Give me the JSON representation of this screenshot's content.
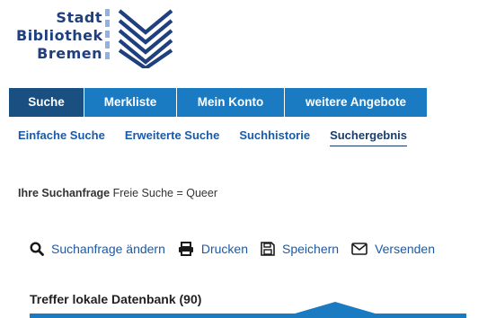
{
  "logo": {
    "line1": "Stadt",
    "line2": "Bibliothek",
    "line3": "Bremen",
    "icon": "book-icon",
    "color": "#1f3f7f"
  },
  "mainnav": {
    "items": [
      {
        "label": "Suche",
        "active": true
      },
      {
        "label": "Merkliste",
        "active": false
      },
      {
        "label": "Mein Konto",
        "active": false
      },
      {
        "label": "weitere Angebote",
        "active": false
      }
    ]
  },
  "subnav": {
    "items": [
      {
        "label": "Einfache Suche",
        "active": false
      },
      {
        "label": "Erweiterte Suche",
        "active": false
      },
      {
        "label": "Suchhistorie",
        "active": false
      },
      {
        "label": "Suchergebnis",
        "active": true
      }
    ]
  },
  "query": {
    "label": "Ihre Suchanfrage",
    "text": "Freie Suche = Queer"
  },
  "actions": [
    {
      "label": "Suchanfrage ändern",
      "icon": "search-icon"
    },
    {
      "label": "Drucken",
      "icon": "print-icon"
    },
    {
      "label": "Speichern",
      "icon": "save-icon"
    },
    {
      "label": "Versenden",
      "icon": "mail-icon"
    }
  ],
  "results": {
    "title": "Treffer lokale Datenbank (90)"
  },
  "colors": {
    "nav_blue": "#1a7ac2",
    "nav_active": "#1a4f82",
    "link_blue": "#1a5aa8"
  }
}
